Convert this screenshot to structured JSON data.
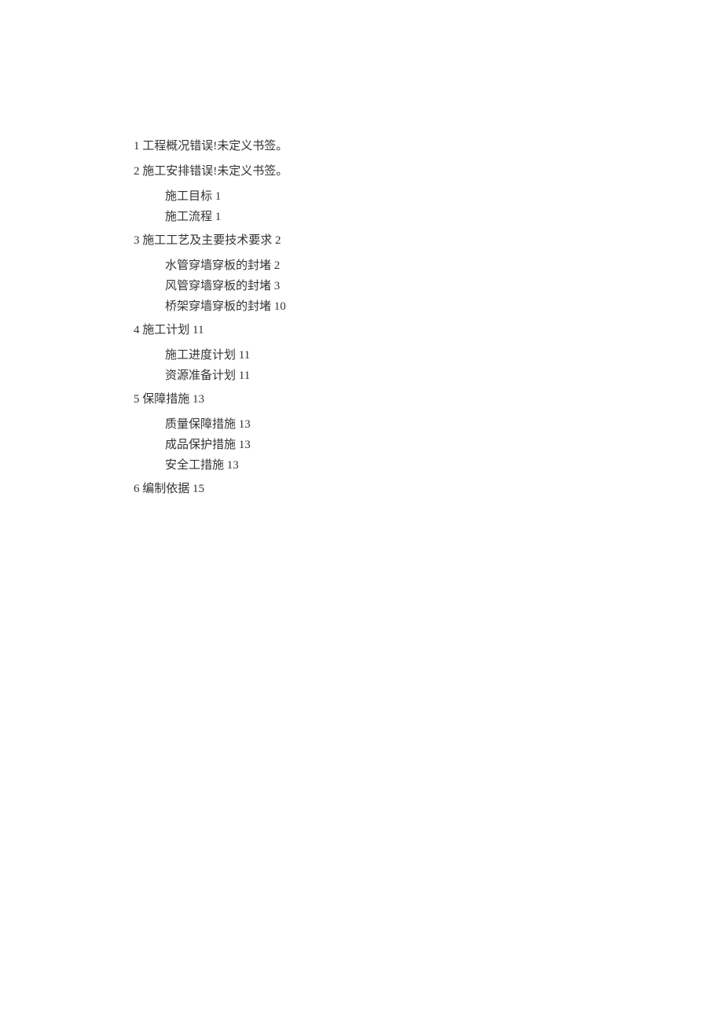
{
  "toc": {
    "sections": [
      {
        "heading": "1 工程概况错误!未定义书签。",
        "items": []
      },
      {
        "heading": "2 施工安排错误!未定义书签。",
        "items": [
          "施工目标 1",
          "施工流程 1"
        ]
      },
      {
        "heading": "3 施工工艺及主要技术要求 2",
        "items": [
          "水管穿墙穿板的封堵 2",
          "风管穿墙穿板的封堵 3",
          "桥架穿墙穿板的封堵 10"
        ]
      },
      {
        "heading": "4 施工计划 11",
        "items": [
          "施工进度计划 11",
          "资源准备计划 11"
        ]
      },
      {
        "heading": "5 保障措施 13",
        "items": [
          "质量保障措施 13",
          "成品保护措施 13",
          "安全工措施 13"
        ]
      },
      {
        "heading": "6 编制依据 15",
        "items": []
      }
    ]
  }
}
